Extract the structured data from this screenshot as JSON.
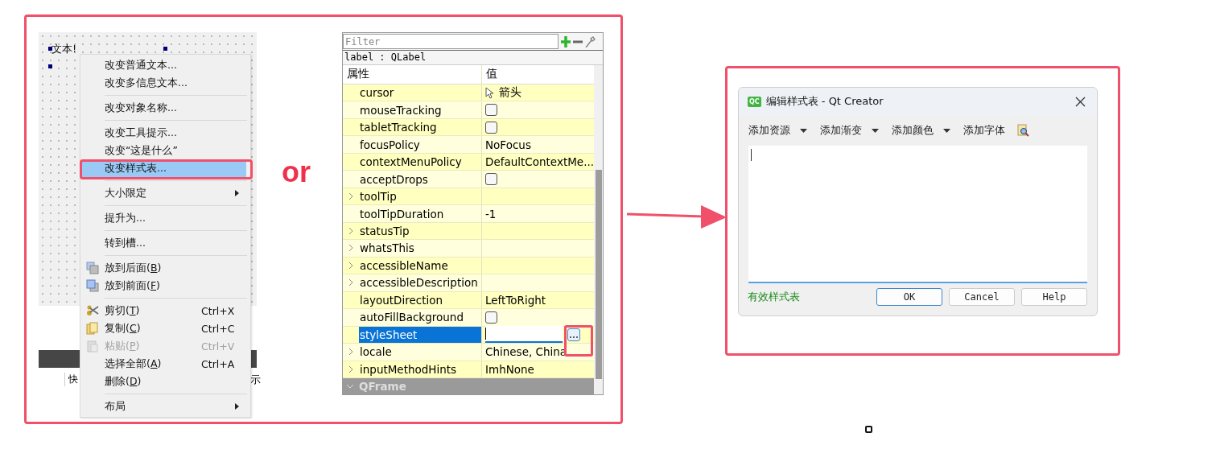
{
  "designer": {
    "label_text": "文本!",
    "tab_text_left": "快",
    "tab_text_right": "示"
  },
  "context_menu": {
    "items": [
      {
        "kind": "item",
        "label": "改变普通文本...",
        "selected": false,
        "disabled": false
      },
      {
        "kind": "item",
        "label": "改变多信息文本...",
        "selected": false,
        "disabled": false
      },
      {
        "kind": "separator"
      },
      {
        "kind": "item",
        "label": "改变对象名称...",
        "selected": false,
        "disabled": false
      },
      {
        "kind": "separator"
      },
      {
        "kind": "item",
        "label": "改变工具提示...",
        "selected": false,
        "disabled": false
      },
      {
        "kind": "item",
        "label": "改变“这是什么”",
        "selected": false,
        "disabled": false
      },
      {
        "kind": "item",
        "label": "改变样式表...",
        "selected": true,
        "disabled": false
      },
      {
        "kind": "separator"
      },
      {
        "kind": "item",
        "label": "大小限定",
        "selected": false,
        "disabled": false,
        "submenu": true
      },
      {
        "kind": "separator"
      },
      {
        "kind": "item",
        "label": "提升为...",
        "selected": false,
        "disabled": false
      },
      {
        "kind": "separator"
      },
      {
        "kind": "item",
        "label": "转到槽...",
        "selected": false,
        "disabled": false
      },
      {
        "kind": "separator"
      },
      {
        "kind": "item",
        "label": "放到后面(**B**)",
        "selected": false,
        "disabled": false,
        "icon": true
      },
      {
        "kind": "item",
        "label": "放到前面(**F**)",
        "selected": false,
        "disabled": false,
        "icon": true
      },
      {
        "kind": "separator"
      },
      {
        "kind": "item",
        "label": "剪切(**T**)",
        "shortcut": "Ctrl+X",
        "selected": false,
        "disabled": false,
        "icon": true
      },
      {
        "kind": "item",
        "label": "复制(**C**)",
        "shortcut": "Ctrl+C",
        "selected": false,
        "disabled": false,
        "icon": true
      },
      {
        "kind": "item",
        "label": "粘贴(**P**)",
        "shortcut": "Ctrl+V",
        "selected": false,
        "disabled": true,
        "icon": true
      },
      {
        "kind": "item",
        "label": "选择全部(**A**)",
        "shortcut": "Ctrl+A",
        "selected": false,
        "disabled": false
      },
      {
        "kind": "item",
        "label": "删除(**D**)",
        "selected": false,
        "disabled": false
      },
      {
        "kind": "separator"
      },
      {
        "kind": "item",
        "label": "布局",
        "selected": false,
        "disabled": false,
        "submenu": true
      }
    ]
  },
  "or_text": "or",
  "property_editor": {
    "filter_placeholder": "Filter",
    "object_label": "label : QLabel",
    "columns": [
      "属性",
      "值"
    ],
    "rows": [
      {
        "name": "cursor",
        "kind": "cursor",
        "value": "箭头",
        "expandable": false,
        "selected": false
      },
      {
        "name": "mouseTracking",
        "kind": "checkbox",
        "checked": false,
        "expandable": false,
        "selected": false
      },
      {
        "name": "tabletTracking",
        "kind": "checkbox",
        "checked": false,
        "expandable": false,
        "selected": false
      },
      {
        "name": "focusPolicy",
        "kind": "text",
        "value": "NoFocus",
        "expandable": false,
        "selected": false
      },
      {
        "name": "contextMenuPolicy",
        "kind": "text",
        "value": "DefaultContextMe...",
        "expandable": false,
        "selected": false
      },
      {
        "name": "acceptDrops",
        "kind": "checkbox",
        "checked": false,
        "expandable": false,
        "selected": false
      },
      {
        "name": "toolTip",
        "kind": "text",
        "expandable": true,
        "selected": false
      },
      {
        "name": "toolTipDuration",
        "kind": "text",
        "value": "-1",
        "expandable": false,
        "selected": false
      },
      {
        "name": "statusTip",
        "kind": "text",
        "expandable": true,
        "selected": false
      },
      {
        "name": "whatsThis",
        "kind": "text",
        "expandable": true,
        "selected": false
      },
      {
        "name": "accessibleName",
        "kind": "text",
        "expandable": true,
        "selected": false
      },
      {
        "name": "accessibleDescription",
        "kind": "text",
        "expandable": true,
        "selected": false
      },
      {
        "name": "layoutDirection",
        "kind": "text",
        "value": "LeftToRight",
        "expandable": false,
        "selected": false
      },
      {
        "name": "autoFillBackground",
        "kind": "checkbox",
        "checked": false,
        "expandable": false,
        "selected": false
      },
      {
        "name": "styleSheet",
        "kind": "editor",
        "expandable": false,
        "selected": true
      },
      {
        "name": "locale",
        "kind": "text",
        "value": "Chinese, China",
        "expandable": true,
        "selected": false
      },
      {
        "name": "inputMethodHints",
        "kind": "text",
        "value": "ImhNone",
        "expandable": true,
        "selected": false
      }
    ],
    "group_header": "QFrame"
  },
  "dialog": {
    "title": "编辑样式表 - Qt Creator",
    "app_badge": "QC",
    "toolbar": [
      {
        "label": "添加资源",
        "dropdown": true
      },
      {
        "label": "添加渐变",
        "dropdown": true
      },
      {
        "label": "添加颜色",
        "dropdown": true
      },
      {
        "label": "添加字体",
        "dropdown": false
      }
    ],
    "status": "有效样式表",
    "buttons": [
      {
        "label": "OK",
        "default": true
      },
      {
        "label": "Cancel",
        "default": false
      },
      {
        "label": "Help",
        "default": false
      }
    ]
  }
}
